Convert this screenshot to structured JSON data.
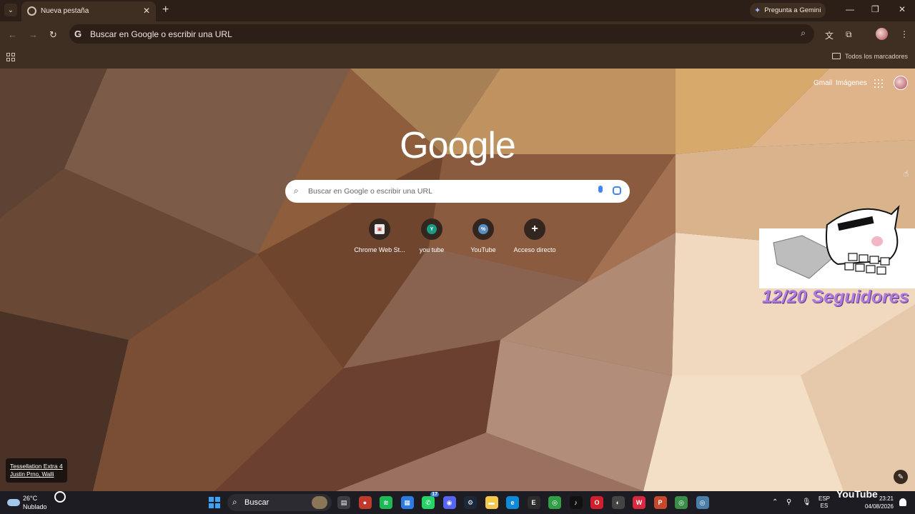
{
  "browser": {
    "tab": {
      "title": "Nueva pestaña",
      "close_icon": "close-icon"
    },
    "new_tab_symbol": "+",
    "tab_list_symbol": "⌄",
    "gemini_label": "Pregunta a Gemini",
    "window_controls": {
      "minimize": "—",
      "maximize": "❐",
      "close": "✕"
    },
    "nav": {
      "back": "←",
      "forward": "→",
      "reload": "↻"
    },
    "omnibox": {
      "g_label": "G",
      "text": "Buscar en Google o escribir una URL",
      "zoom_icon": "⌕"
    },
    "toolbar_icons": {
      "extensions": "⧉",
      "menu": "⋮",
      "translate": "文"
    },
    "bookmarks_all_label": "Todos los marcadores"
  },
  "newtab": {
    "links": {
      "gmail": "Gmail",
      "images": "Imágenes"
    },
    "logo": "Google",
    "search": {
      "placeholder": "Buscar en Google o escribir una URL",
      "icon": "⌕"
    },
    "shortcuts": [
      {
        "label": "Chrome Web St...",
        "glyph": "▣",
        "color": "#e8eaed"
      },
      {
        "label": "you tube",
        "glyph": "Y",
        "color": "#1b9c85"
      },
      {
        "label": "YouTube",
        "glyph": "%",
        "color": "#5a8fc4"
      },
      {
        "label": "Acceso directo",
        "glyph": "+",
        "color": "transparent"
      }
    ],
    "overlay_text": "12/20 Seguidores",
    "credit": {
      "line1": "Tessellation Extra 4",
      "line2": "Justin Prno, Walli"
    },
    "edit_icon": "✎"
  },
  "taskbar": {
    "weather": {
      "temp": "26°C",
      "condition": "Nublado"
    },
    "search_label": "Buscar",
    "search_icon": "⌕",
    "apps": [
      {
        "name": "file-explorer-icon",
        "glyph": "▤",
        "color": "#3c3c44"
      },
      {
        "name": "colorful-app-icon",
        "glyph": "●",
        "color": "#c0392b"
      },
      {
        "name": "spotify-icon",
        "glyph": "≋",
        "color": "#1db954"
      },
      {
        "name": "store-icon",
        "glyph": "▦",
        "color": "#2c7be5"
      },
      {
        "name": "whatsapp-icon",
        "glyph": "✆",
        "color": "#25d366",
        "badge": "17"
      },
      {
        "name": "discord-icon",
        "glyph": "◉",
        "color": "#5865f2"
      },
      {
        "name": "steam-icon",
        "glyph": "⚙",
        "color": "#1b2838"
      },
      {
        "name": "folder-icon",
        "glyph": "▬",
        "color": "#f2c94c"
      },
      {
        "name": "edge-icon",
        "glyph": "e",
        "color": "#0f8ad8"
      },
      {
        "name": "epic-icon",
        "glyph": "E",
        "color": "#2c2c2c"
      },
      {
        "name": "chrome-icon",
        "glyph": "◎",
        "color": "#2f9e44"
      },
      {
        "name": "tiktok-icon",
        "glyph": "♪",
        "color": "#111111"
      },
      {
        "name": "opera-icon",
        "glyph": "O",
        "color": "#d21f2d"
      },
      {
        "name": "obs-icon",
        "glyph": "◐",
        "color": "#444444"
      },
      {
        "name": "wps-icon",
        "glyph": "W",
        "color": "#d9283f"
      },
      {
        "name": "powerpoint-icon",
        "glyph": "P",
        "color": "#c7482c"
      },
      {
        "name": "chrome-icon-2",
        "glyph": "◎",
        "color": "#3a8e4a"
      },
      {
        "name": "chrome-icon-3",
        "glyph": "◎",
        "color": "#4a7ea8"
      }
    ],
    "tray": {
      "chevron": "⌃",
      "lang": "ESP",
      "lang_sub": "ES",
      "time": "23:21",
      "date": "04/08/2026",
      "yt_text": "YouTube"
    }
  },
  "colors": {
    "tab_bar": "#2b1f17",
    "toolbar": "#3f2e22",
    "accent_blue": "#4285f4"
  }
}
